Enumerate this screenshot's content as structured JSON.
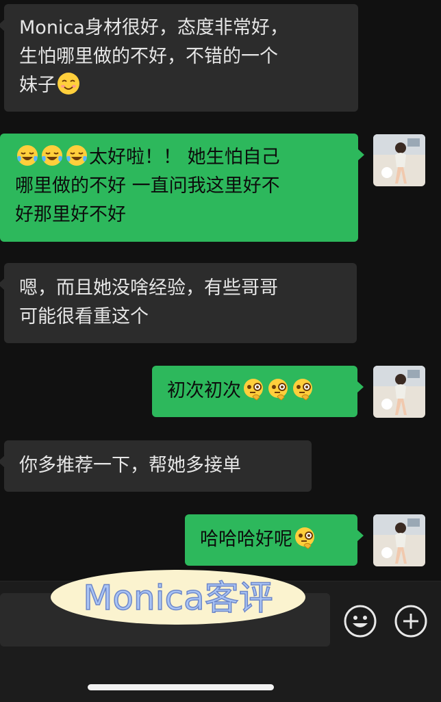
{
  "messages": [
    {
      "side": "in",
      "lines": [
        "Monica身材很好，态度非常好，",
        "生怕哪里做的不好，不错的一个",
        "妹子"
      ],
      "trailing_emoji": [
        "smiling-face-emoji"
      ]
    },
    {
      "side": "out",
      "leading_emoji": [
        "tears-of-joy-emoji",
        "tears-of-joy-emoji",
        "tears-of-joy-emoji"
      ],
      "lines": [
        "太好啦！！ 她生怕自己",
        "哪里做的不好 一直问我这里好不",
        "好那里好不好"
      ]
    },
    {
      "side": "in",
      "lines": [
        "嗯，而且她没啥经验，有些哥哥",
        "可能很看重这个"
      ]
    },
    {
      "side": "out",
      "lines": [
        "初次初次"
      ],
      "trailing_emoji": [
        "thinking-monocle-emoji",
        "thinking-monocle-emoji",
        "thinking-monocle-emoji"
      ]
    },
    {
      "side": "in",
      "lines": [
        "你多推荐一下，帮她多接单"
      ]
    },
    {
      "side": "out",
      "lines": [
        "哈哈哈好呢"
      ],
      "trailing_emoji": [
        "thinking-monocle-emoji"
      ]
    }
  ],
  "watermark": "Monica客评",
  "colors": {
    "background": "#111111",
    "incoming": "#2c2c2c",
    "outgoing": "#2db85c"
  }
}
